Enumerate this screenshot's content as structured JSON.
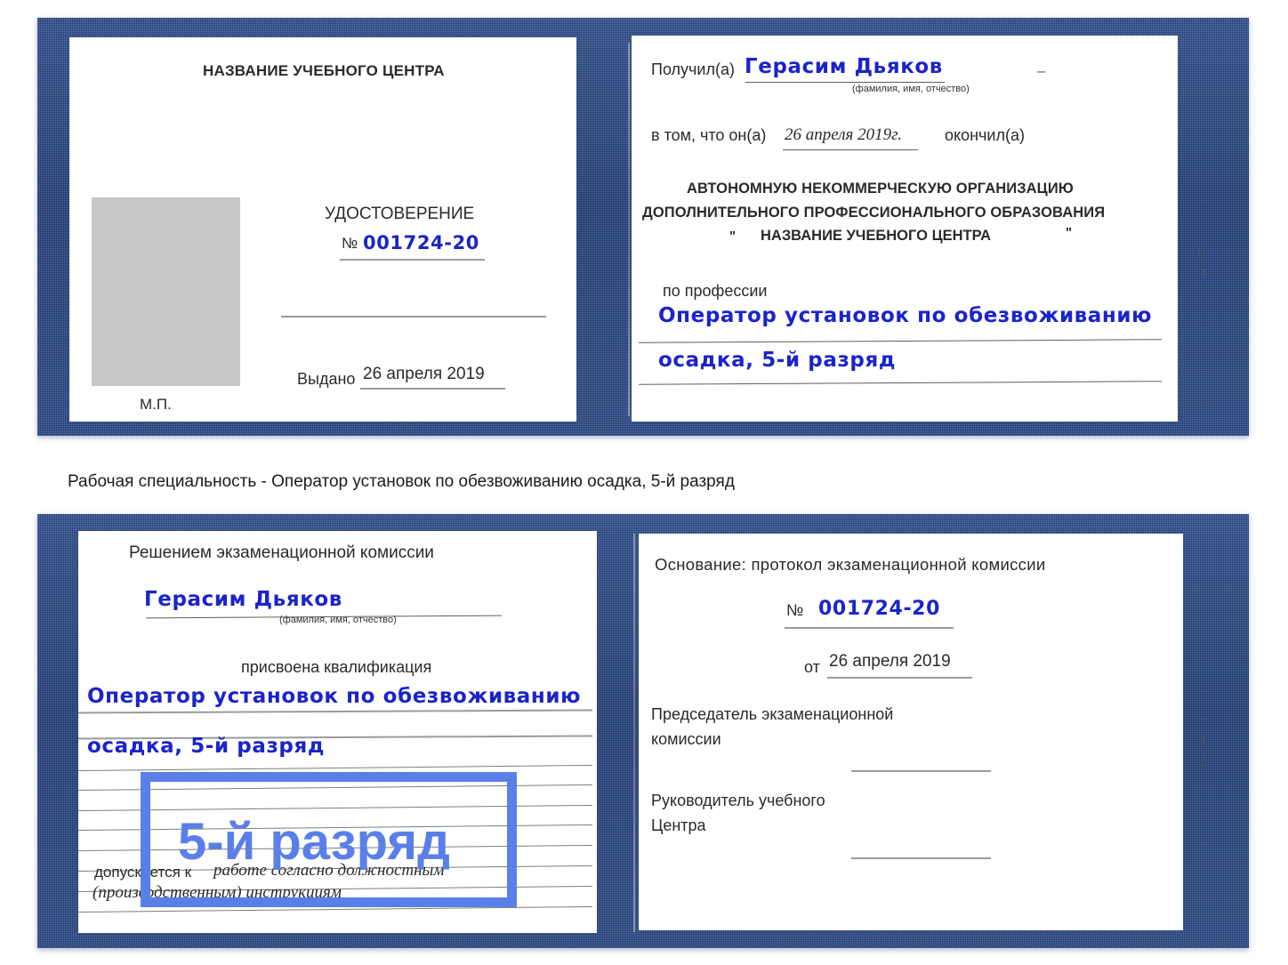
{
  "caption": "Рабочая специальность - Оператор установок по обезвоживанию осадка, 5-й разряд",
  "certificate_top": {
    "left_page": {
      "title": "НАЗВАНИЕ УЧЕБНОГО ЦЕНТРА",
      "doc_type": "УДОСТОВЕРЕНИЕ",
      "number_label": "№",
      "number_value": "001724-20",
      "issued_label": "Выдано",
      "issued_value": "26 апреля 2019",
      "stamp_label": "М.П.",
      "photo_placeholder": "photo-placeholder"
    },
    "right_page": {
      "received_label": "Получил(а)",
      "received_value": "Герасим Дьяков",
      "fio_hint": "(фамилия, имя, отчество)",
      "in_that_label": "в том, что он(а)",
      "completion_date": "26 апреля 2019г.",
      "finished_label": "окончил(а)",
      "org_line1": "АВТОНОМНУЮ НЕКОММЕРЧЕСКУЮ ОРГАНИЗАЦИЮ",
      "org_line2": "ДОПОЛНИТЕЛЬНОГО ПРОФЕССИОНАЛЬНОГО ОБРАЗОВАНИЯ",
      "org_quote_open": "\"",
      "org_name": "НАЗВАНИЕ УЧЕБНОГО ЦЕНТРА",
      "org_quote_close": "\"",
      "profession_label": "по профессии",
      "profession_line1": "Оператор установок по обезвоживанию",
      "profession_line2": "осадка, 5-й разряд",
      "edge_marks": [
        "–",
        "–",
        "–",
        "и",
        ",а",
        "‹-",
        "–",
        "–",
        "–",
        "–"
      ]
    }
  },
  "certificate_bottom": {
    "left_page": {
      "title": "Решением экзаменационной комиссии",
      "name_value": "Герасим Дьяков",
      "fio_hint": "(фамилия, имя, отчество)",
      "qualification_label": "присвоена квалификация",
      "qualification_line1": "Оператор установок по обезвоживанию",
      "qualification_line2": "осадка, 5-й разряд",
      "admitted_label": "допускается к",
      "admitted_value_line1": "работе согласно должностным",
      "admitted_value_line2": "(производственным) инструкциям"
    },
    "right_page": {
      "basis_label": "Основание: протокол экзаменационной комиссии",
      "number_label": "№",
      "number_value": "001724-20",
      "from_label": "от",
      "from_value": "26 апреля 2019",
      "chairman_line1": "Председатель экзаменационной",
      "chairman_line2": "комиссии",
      "head_line1": "Руководитель учебного",
      "head_line2": "Центра",
      "edge_marks": [
        "–",
        "–",
        "–",
        "и",
        ",а",
        "‹-",
        "–",
        "–",
        "–",
        "–"
      ]
    }
  },
  "annotation": {
    "highlight_text": "5-й разряд",
    "highlight_color": "#5b7fe8"
  },
  "colors": {
    "cover_blue": "#27457f",
    "handwriting_blue": "#1b24c9",
    "accent_blue": "#5b7fe8",
    "photo_gray": "#c8c8c8",
    "page_white": "#ffffff"
  }
}
